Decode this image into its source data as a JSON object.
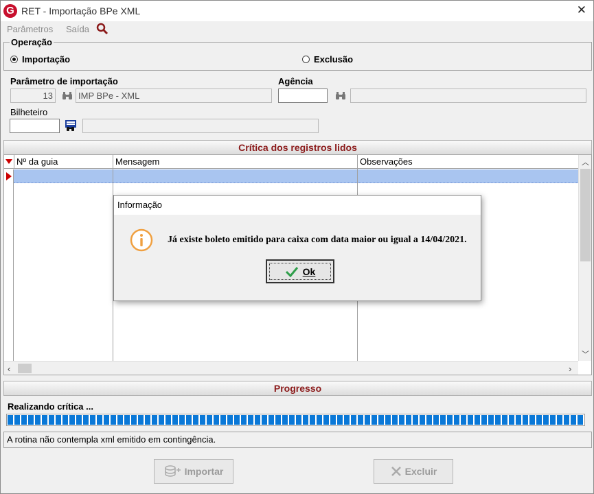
{
  "window": {
    "title": "RET - Importação BPe XML",
    "logo_letter": "G",
    "close_glyph": "✕"
  },
  "menu": {
    "items": [
      "Parâmetros",
      "Saída"
    ],
    "search_icon": "search-icon"
  },
  "operacao": {
    "label": "Operação",
    "options": [
      {
        "label": "Importação",
        "selected": true
      },
      {
        "label": "Exclusão",
        "selected": false
      }
    ]
  },
  "parametro": {
    "label": "Parâmetro de importação",
    "code": "13",
    "description": "IMP BPe - XML"
  },
  "agencia": {
    "label": "Agência",
    "code": "",
    "name": ""
  },
  "bilheteiro": {
    "label": "Bilheteiro",
    "code": "",
    "name": ""
  },
  "critica": {
    "title": "Crítica dos registros lidos",
    "columns": [
      "Nº da guia",
      "Mensagem",
      "Observações"
    ],
    "rows": [
      {
        "guia": "",
        "mensagem": "",
        "observacoes": ""
      }
    ]
  },
  "progresso": {
    "title": "Progresso",
    "label": "Realizando crítica ...",
    "percent": 100
  },
  "status_text": "A rotina não contempla xml emitido em contingência.",
  "buttons": {
    "importar": "Importar",
    "excluir": "Excluir"
  },
  "dialog": {
    "title": "Informação",
    "message": "Já existe boleto emitido para caixa com data maior ou igual a 14/04/2021.",
    "ok_label": "Ok",
    "icon": "info-icon"
  },
  "colors": {
    "accent_red": "#8b1a1a",
    "progress_blue": "#0a78d7",
    "selection": "#a9c5f0",
    "info_orange": "#f0a040",
    "ok_green": "#2e9e4a"
  }
}
